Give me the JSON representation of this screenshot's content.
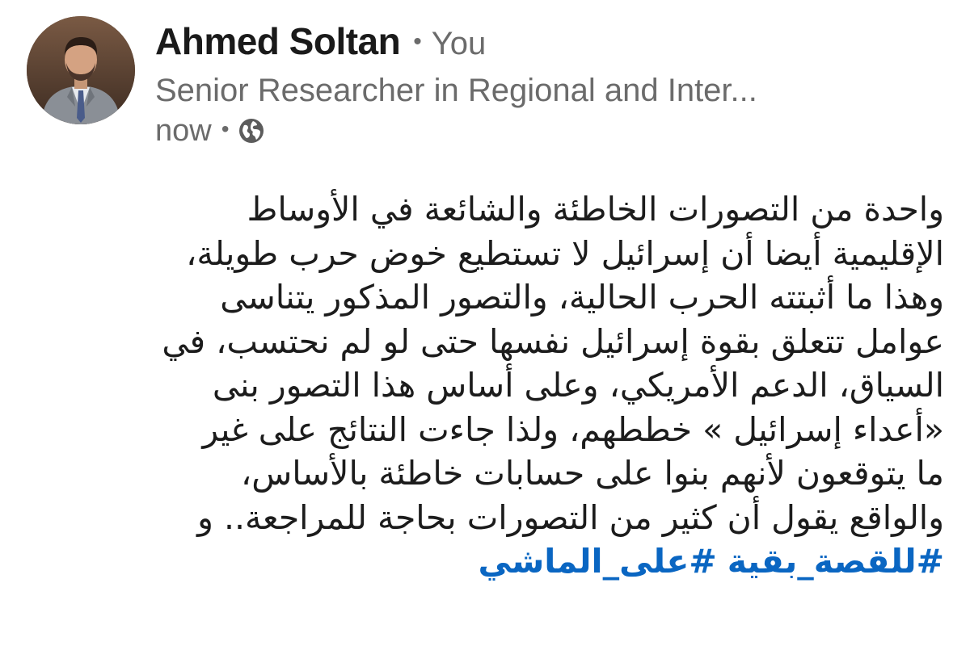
{
  "author": {
    "name": "Ahmed Soltan",
    "separator": "•",
    "relation": "You",
    "headline": "Senior Researcher in Regional and Inter...",
    "time": "now",
    "visibility_icon": "globe-icon"
  },
  "post": {
    "lines": [
      "واحدة من التصورات الخاطئة والشائعة في الأوساط",
      "الإقليمية أيضا أن إسرائيل لا تستطيع خوض حرب طويلة،",
      "وهذا ما أثبتته الحرب الحالية، والتصور المذكور يتناسى",
      "عوامل تتعلق بقوة إسرائيل نفسها حتى لو لم نحتسب، في",
      "السياق، الدعم الأمريكي، وعلى أساس هذا التصور بنى",
      "«أعداء إسرائيل » خططهم، ولذا جاءت النتائج على غير",
      "ما يتوقعون لأنهم بنوا على حسابات خاطئة بالأساس،",
      "والواقع يقول أن كثير من التصورات بحاجة للمراجعة.. و"
    ],
    "hashtags": [
      "#للقصة_بقية",
      "#على_الماشي"
    ]
  },
  "colors": {
    "hashtag": "#0a66c2",
    "meta_text": "#6b6b6b",
    "body_text": "#1c1c1c"
  }
}
